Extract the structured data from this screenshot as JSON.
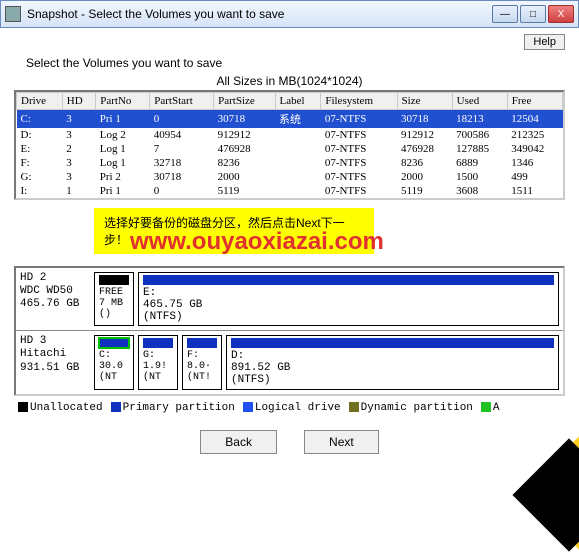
{
  "window": {
    "title": "Snapshot - Select the Volumes you want to save",
    "help": "Help",
    "minimize": "—",
    "maximize": "□",
    "close": "X"
  },
  "subtitle": "Select the Volumes you want to save",
  "all_sizes": "All Sizes in MB(1024*1024)",
  "columns": [
    "Drive",
    "HD",
    "PartNo",
    "PartStart",
    "PartSize",
    "Label",
    "Filesystem",
    "Size",
    "Used",
    "Free"
  ],
  "rows": [
    {
      "sel": true,
      "Drive": "C:",
      "HD": "3",
      "PartNo": "Pri 1",
      "PartStart": "0",
      "PartSize": "30718",
      "Label": "系统",
      "Filesystem": "07-NTFS",
      "Size": "30718",
      "Used": "18213",
      "Free": "12504"
    },
    {
      "sel": false,
      "Drive": "D:",
      "HD": "3",
      "PartNo": "Log 2",
      "PartStart": "40954",
      "PartSize": "912912",
      "Label": "",
      "Filesystem": "07-NTFS",
      "Size": "912912",
      "Used": "700586",
      "Free": "212325"
    },
    {
      "sel": false,
      "Drive": "E:",
      "HD": "2",
      "PartNo": "Log 1",
      "PartStart": "7",
      "PartSize": "476928",
      "Label": "",
      "Filesystem": "07-NTFS",
      "Size": "476928",
      "Used": "127885",
      "Free": "349042"
    },
    {
      "sel": false,
      "Drive": "F:",
      "HD": "3",
      "PartNo": "Log 1",
      "PartStart": "32718",
      "PartSize": "8236",
      "Label": "",
      "Filesystem": "07-NTFS",
      "Size": "8236",
      "Used": "6889",
      "Free": "1346"
    },
    {
      "sel": false,
      "Drive": "G:",
      "HD": "3",
      "PartNo": "Pri 2",
      "PartStart": "30718",
      "PartSize": "2000",
      "Label": "",
      "Filesystem": "07-NTFS",
      "Size": "2000",
      "Used": "1500",
      "Free": "499"
    },
    {
      "sel": false,
      "Drive": "I:",
      "HD": "1",
      "PartNo": "Pri 1",
      "PartStart": "0",
      "PartSize": "5119",
      "Label": "",
      "Filesystem": "07-NTFS",
      "Size": "5119",
      "Used": "3608",
      "Free": "1511"
    }
  ],
  "hint": "选择好要备份的磁盘分区，然后点击Next下一步！",
  "watermark": "www.ouyaoxiazai.com",
  "disks": {
    "hd2": {
      "label": "HD 2\nWDC WD50\n465.76 GB",
      "free": "FREE\n7 MB\n()",
      "part": "E:\n465.75 GB\n(NTFS)"
    },
    "hd3": {
      "label": "HD 3\nHitachi\n931.51 GB",
      "c": "C:\n30.0\n(NT",
      "g": "G:\n1.9!\n(NT",
      "f": "F:\n8.0·\n(NT!",
      "d": "D:\n891.52 GB\n(NTFS)"
    }
  },
  "legend": {
    "unalloc": "Unallocated",
    "primary": "Primary partition",
    "logical": "Logical drive",
    "dynamic": "Dynamic partition",
    "a": "A"
  },
  "buttons": {
    "back": "Back",
    "next": "Next"
  },
  "colors": {
    "unalloc": "#000000",
    "primary": "#1030c0",
    "logical": "#2050f0",
    "dynamic": "#707020",
    "a": "#20c020"
  }
}
